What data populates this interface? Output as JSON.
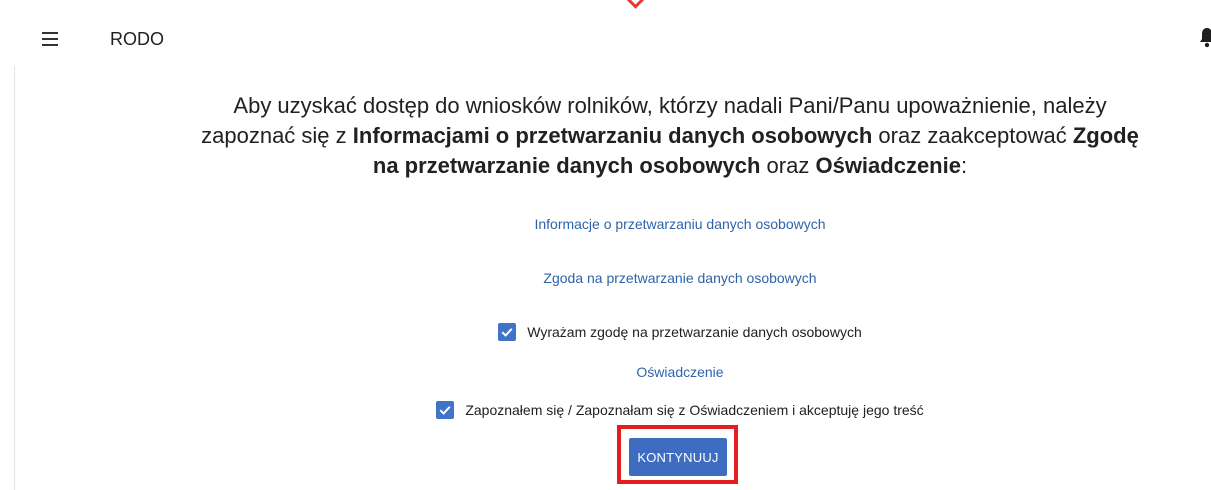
{
  "header": {
    "title": "RODO",
    "menu_icon": "hamburger-menu-icon",
    "notifications_icon": "bell-icon"
  },
  "intro": {
    "part1": "Aby uzyskać dostęp do wniosków rolników, którzy nadali Pani/Panu upoważnienie, należy zapoznać się z ",
    "bold1": "Informacjami o przetwarzaniu danych osobowych",
    "part2": " oraz zaakceptować ",
    "bold2": "Zgodę na przetwarzanie danych osobowych",
    "part3": " oraz ",
    "bold3": "Oświadczenie",
    "part4": ":"
  },
  "links": {
    "info_processing": "Informacje o przetwarzaniu danych osobowych",
    "consent": "Zgoda na przetwarzanie danych osobowych",
    "statement": "Oświadczenie"
  },
  "checkboxes": {
    "consent": {
      "label": "Wyrażam zgodę na przetwarzanie danych osobowych",
      "checked": true
    },
    "statement": {
      "label": "Zapoznałem się / Zapoznałam się z Oświadczeniem i akceptuję jego treść",
      "checked": true
    }
  },
  "actions": {
    "continue_label": "KONTYNUUJ"
  },
  "colors": {
    "accent": "#3d6cc0",
    "link": "#2f63a9",
    "highlight": "#e41e1e"
  }
}
